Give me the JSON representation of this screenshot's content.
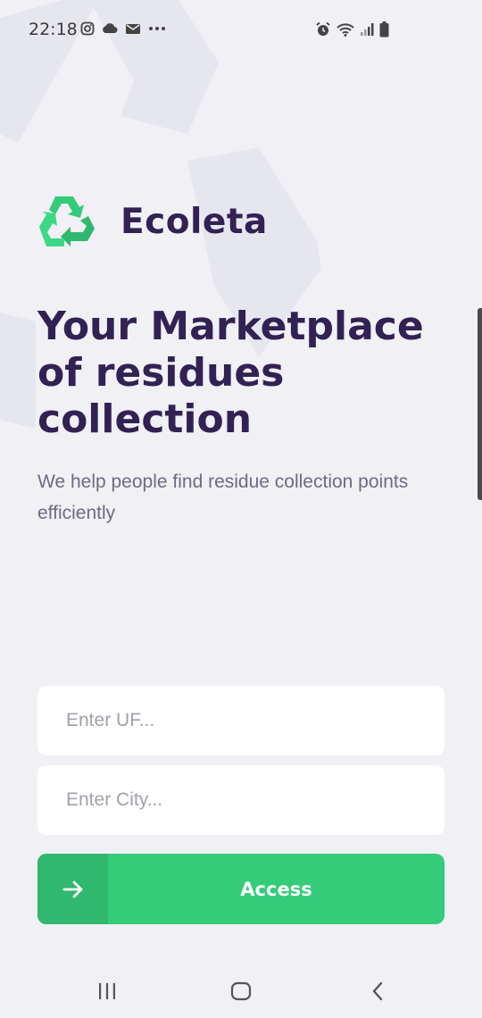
{
  "status_bar": {
    "time": "22:18",
    "left_icons": [
      "instagram-icon",
      "cloud-icon",
      "mail-icon",
      "more-dots-icon"
    ],
    "right_icons": [
      "alarm-icon",
      "wifi-icon",
      "signal-icon",
      "battery-icon"
    ]
  },
  "logo": {
    "name": "Ecoleta",
    "icon": "recycle-icon"
  },
  "hero": {
    "title": "Your Marketplace of residues collection",
    "description": "We help people find residue collection points efficiently"
  },
  "form": {
    "uf": {
      "placeholder": "Enter UF...",
      "value": ""
    },
    "city": {
      "placeholder": "Enter City...",
      "value": ""
    },
    "submit": {
      "label": "Access",
      "icon": "arrow-right-icon"
    }
  },
  "nav_bar": {
    "buttons": [
      "recent-apps-icon",
      "home-icon",
      "back-icon"
    ]
  },
  "colors": {
    "background": "#F0F0F5",
    "brand_dark": "#322153",
    "brand_green": "#34CB79",
    "text_muted": "#6C6C80",
    "placeholder": "#A0A0B2"
  }
}
